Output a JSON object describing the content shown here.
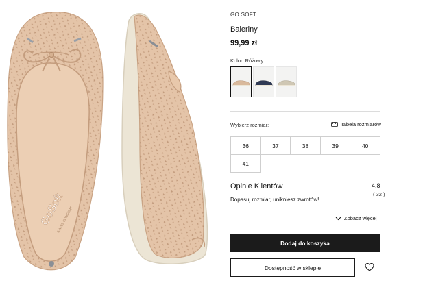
{
  "product": {
    "brand": "GO SOFT",
    "name": "Baleriny",
    "price": "99,99 zł",
    "image_brand_text": "GoSoft",
    "image_sub_text": "SWISS COMFORT"
  },
  "color": {
    "label": "Kolor: Różowy",
    "swatches": [
      {
        "name": "Różowy",
        "hex": "#d9b99c",
        "selected": true
      },
      {
        "name": "Granatowy",
        "hex": "#2f3a55",
        "selected": false
      },
      {
        "name": "Beżowy",
        "hex": "#cfc7b4",
        "selected": false
      }
    ]
  },
  "size": {
    "label": "Wybierz rozmiar:",
    "table_link": "Tabela rozmiarów",
    "options": [
      "36",
      "37",
      "38",
      "39",
      "40",
      "41"
    ]
  },
  "reviews": {
    "title": "Opinie Klientów",
    "rating": "4.8",
    "count": "( 32 )",
    "subtitle": "Dopasuj rozmiar, unikniesz zwrotów!",
    "see_more": "Zobacz więcej"
  },
  "actions": {
    "add_to_cart": "Dodaj do koszyka",
    "store_availability": "Dostępność w sklepie"
  },
  "colors": {
    "shoe": "#e4c4a8",
    "insole": "#eccfb4",
    "sole": "#ece5d5",
    "button_dark": "#1b1b1b"
  }
}
